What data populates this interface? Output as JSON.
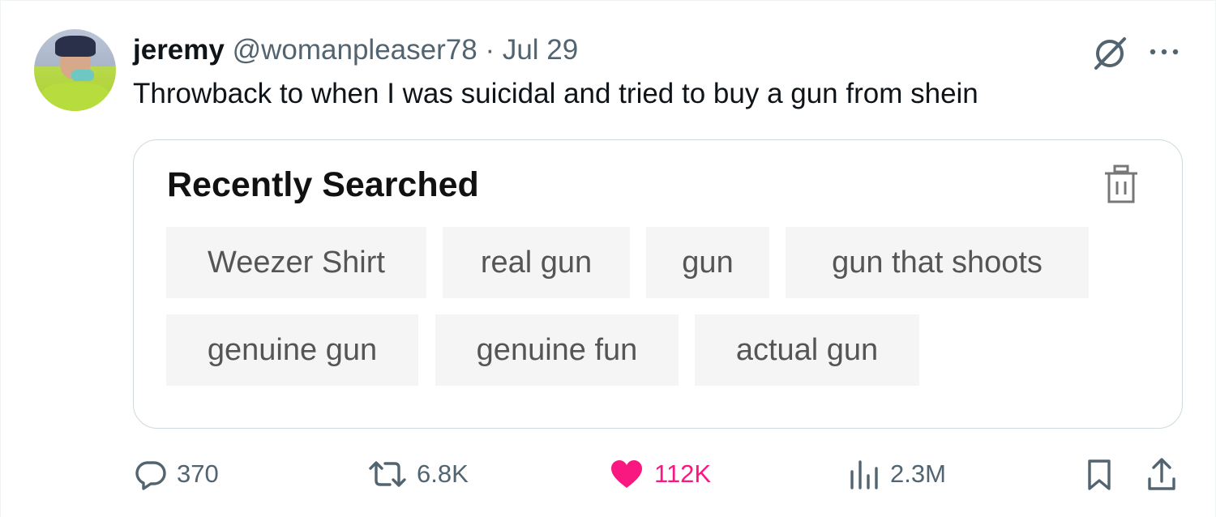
{
  "tweet": {
    "name": "jeremy",
    "handle": "@womanpleaser78",
    "separator": "·",
    "date": "Jul 29",
    "text": "Throwback to when I was suicidal and tried to buy a gun from shein"
  },
  "card": {
    "title": "Recently Searched",
    "chips": [
      "Weezer Shirt",
      "real gun",
      "gun",
      "gun that shoots",
      "genuine gun",
      "genuine fun",
      "actual gun"
    ]
  },
  "actions": {
    "replies": "370",
    "reposts": "6.8K",
    "likes": "112K",
    "views": "2.3M"
  },
  "colors": {
    "like": "#f91880",
    "muted": "#536471",
    "chip_bg": "#f5f5f5",
    "card_border": "#cfd9de"
  },
  "icons": [
    "grok-icon",
    "more-icon",
    "trash-icon",
    "reply-icon",
    "repost-icon",
    "like-icon",
    "views-icon",
    "bookmark-icon",
    "share-icon"
  ]
}
